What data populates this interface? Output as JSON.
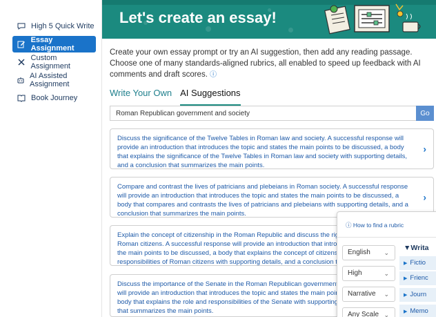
{
  "sidebar": {
    "items": [
      {
        "label": "High 5 Quick Write",
        "icon": "chat-icon"
      },
      {
        "label": "Essay Assignment",
        "icon": "edit-icon",
        "active": true
      },
      {
        "label": "Custom Assignment",
        "icon": "tools-icon"
      },
      {
        "label": "AI Assisted Assignment",
        "icon": "robot-icon"
      },
      {
        "label": "Book Journey",
        "icon": "book-icon"
      }
    ]
  },
  "banner": {
    "title": "Let's create an essay!"
  },
  "description": "Create your own essay prompt or try an AI suggestion, then add any reading passage. Choose one of many standards-aligned rubrics, all enabled to speed up feedback with AI comments and draft scores.",
  "tabs": [
    {
      "label": "Write Your Own"
    },
    {
      "label": "AI Suggestions",
      "active": true
    }
  ],
  "search": {
    "value": "Roman Republican government and society",
    "go_label": "Go"
  },
  "suggestions": [
    {
      "text": "Discuss the significance of the Twelve Tables in Roman law and society. A successful response will provide an introduction that introduces the topic and states the main points to be discussed, a body that explains the significance of the Twelve Tables in Roman law and society with supporting details, and a conclusion that summarizes the main points."
    },
    {
      "text": "Compare and contrast the lives of patricians and plebeians in Roman society. A successful response will provide an introduction that introduces the topic and states the main points to be discussed, a body that compares and contrasts the lives of patricians and plebeians with supporting details, and a conclusion that summarizes the main points."
    },
    {
      "text": "Explain the concept of citizenship in the Roman Republic and discuss the rights and responsibilities of Roman citizens. A successful response will provide an introduction that introduces the topic and states the main points to be discussed, a body that explains the concept of citizenship and the rights and responsibilities of Roman citizens with supporting details, and a conclusion that summarizes the main points."
    },
    {
      "text": "Discuss the importance of the Senate in the Roman Republican government. A successful response will provide an introduction that introduces the topic and states the main points to be discussed, a body that explains the role and responsibilities of the Senate with supporting details, and a conclusion that summarizes the main points."
    }
  ],
  "rubric_popup": {
    "link": "How to find a rubric",
    "selects": [
      "English",
      "High",
      "Narrative",
      "Any Scale"
    ],
    "category_head": "Writa",
    "categories": [
      "Fictio",
      "Frienc",
      "Journ",
      "Memo"
    ]
  },
  "colors": {
    "banner": "#1b8a7f",
    "accent": "#1a73c9",
    "link": "#1e5aa8"
  }
}
